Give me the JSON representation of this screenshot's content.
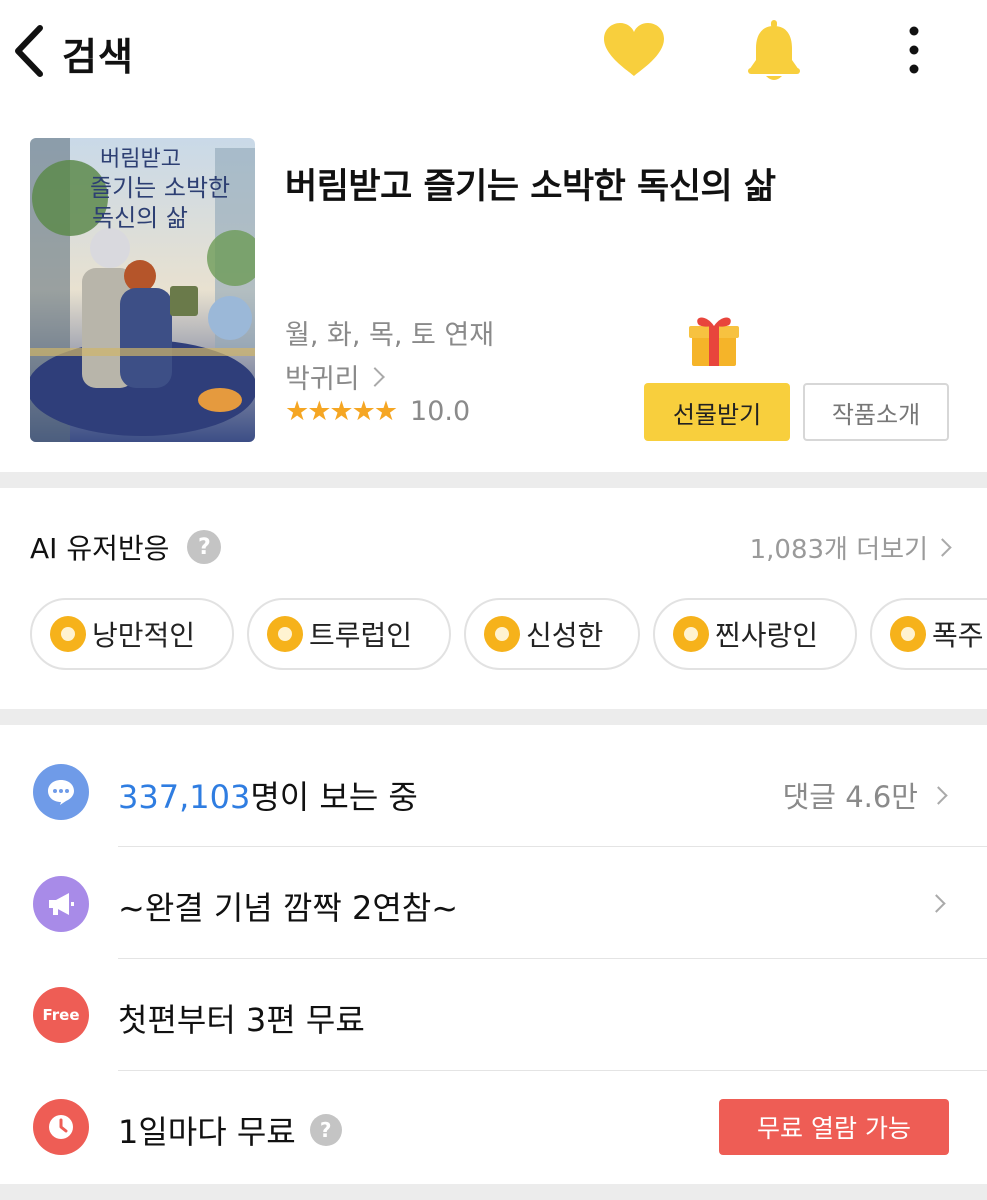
{
  "header": {
    "back_icon": "chevron-left-icon",
    "title": "검색",
    "heart_icon": "heart-icon",
    "bell_icon": "bell-icon",
    "more_icon": "more-vertical-icon",
    "accent_color": "#f8cf3d"
  },
  "work": {
    "cover_icon": "cover-image",
    "title": "버림받고 즐기는 소박한 독신의 삶",
    "schedule": "월, 화, 목, 토 연재",
    "author": "박귀리",
    "stars": "★★★★★",
    "rating": "10.0",
    "gift_icon": "gift-icon",
    "gift_button": "선물받기",
    "intro_button": "작품소개"
  },
  "ai_reactions": {
    "title": "AI 유저반응",
    "help": "?",
    "more": "1,083개 더보기",
    "tags": [
      "낭만적인",
      "트루럽인",
      "신성한",
      "찐사랑인",
      "폭주"
    ]
  },
  "info": {
    "viewers_count": "337,103",
    "viewers_suffix": "명이 보는 중",
    "comments": "댓글 4.6만",
    "event": "~완결 기념 깜짝 2연참~",
    "free_icon_text": "Free",
    "free_text": "첫편부터 3편 무료",
    "daily_text": "1일마다 무료",
    "daily_badge": "무료 열람 가능",
    "colors": {
      "comment_icon": "#6f9be8",
      "event_icon": "#a88be8",
      "free_icon": "#ee5d55",
      "daily_icon": "#ee5d55",
      "viewers_count": "#2f7de1"
    }
  }
}
